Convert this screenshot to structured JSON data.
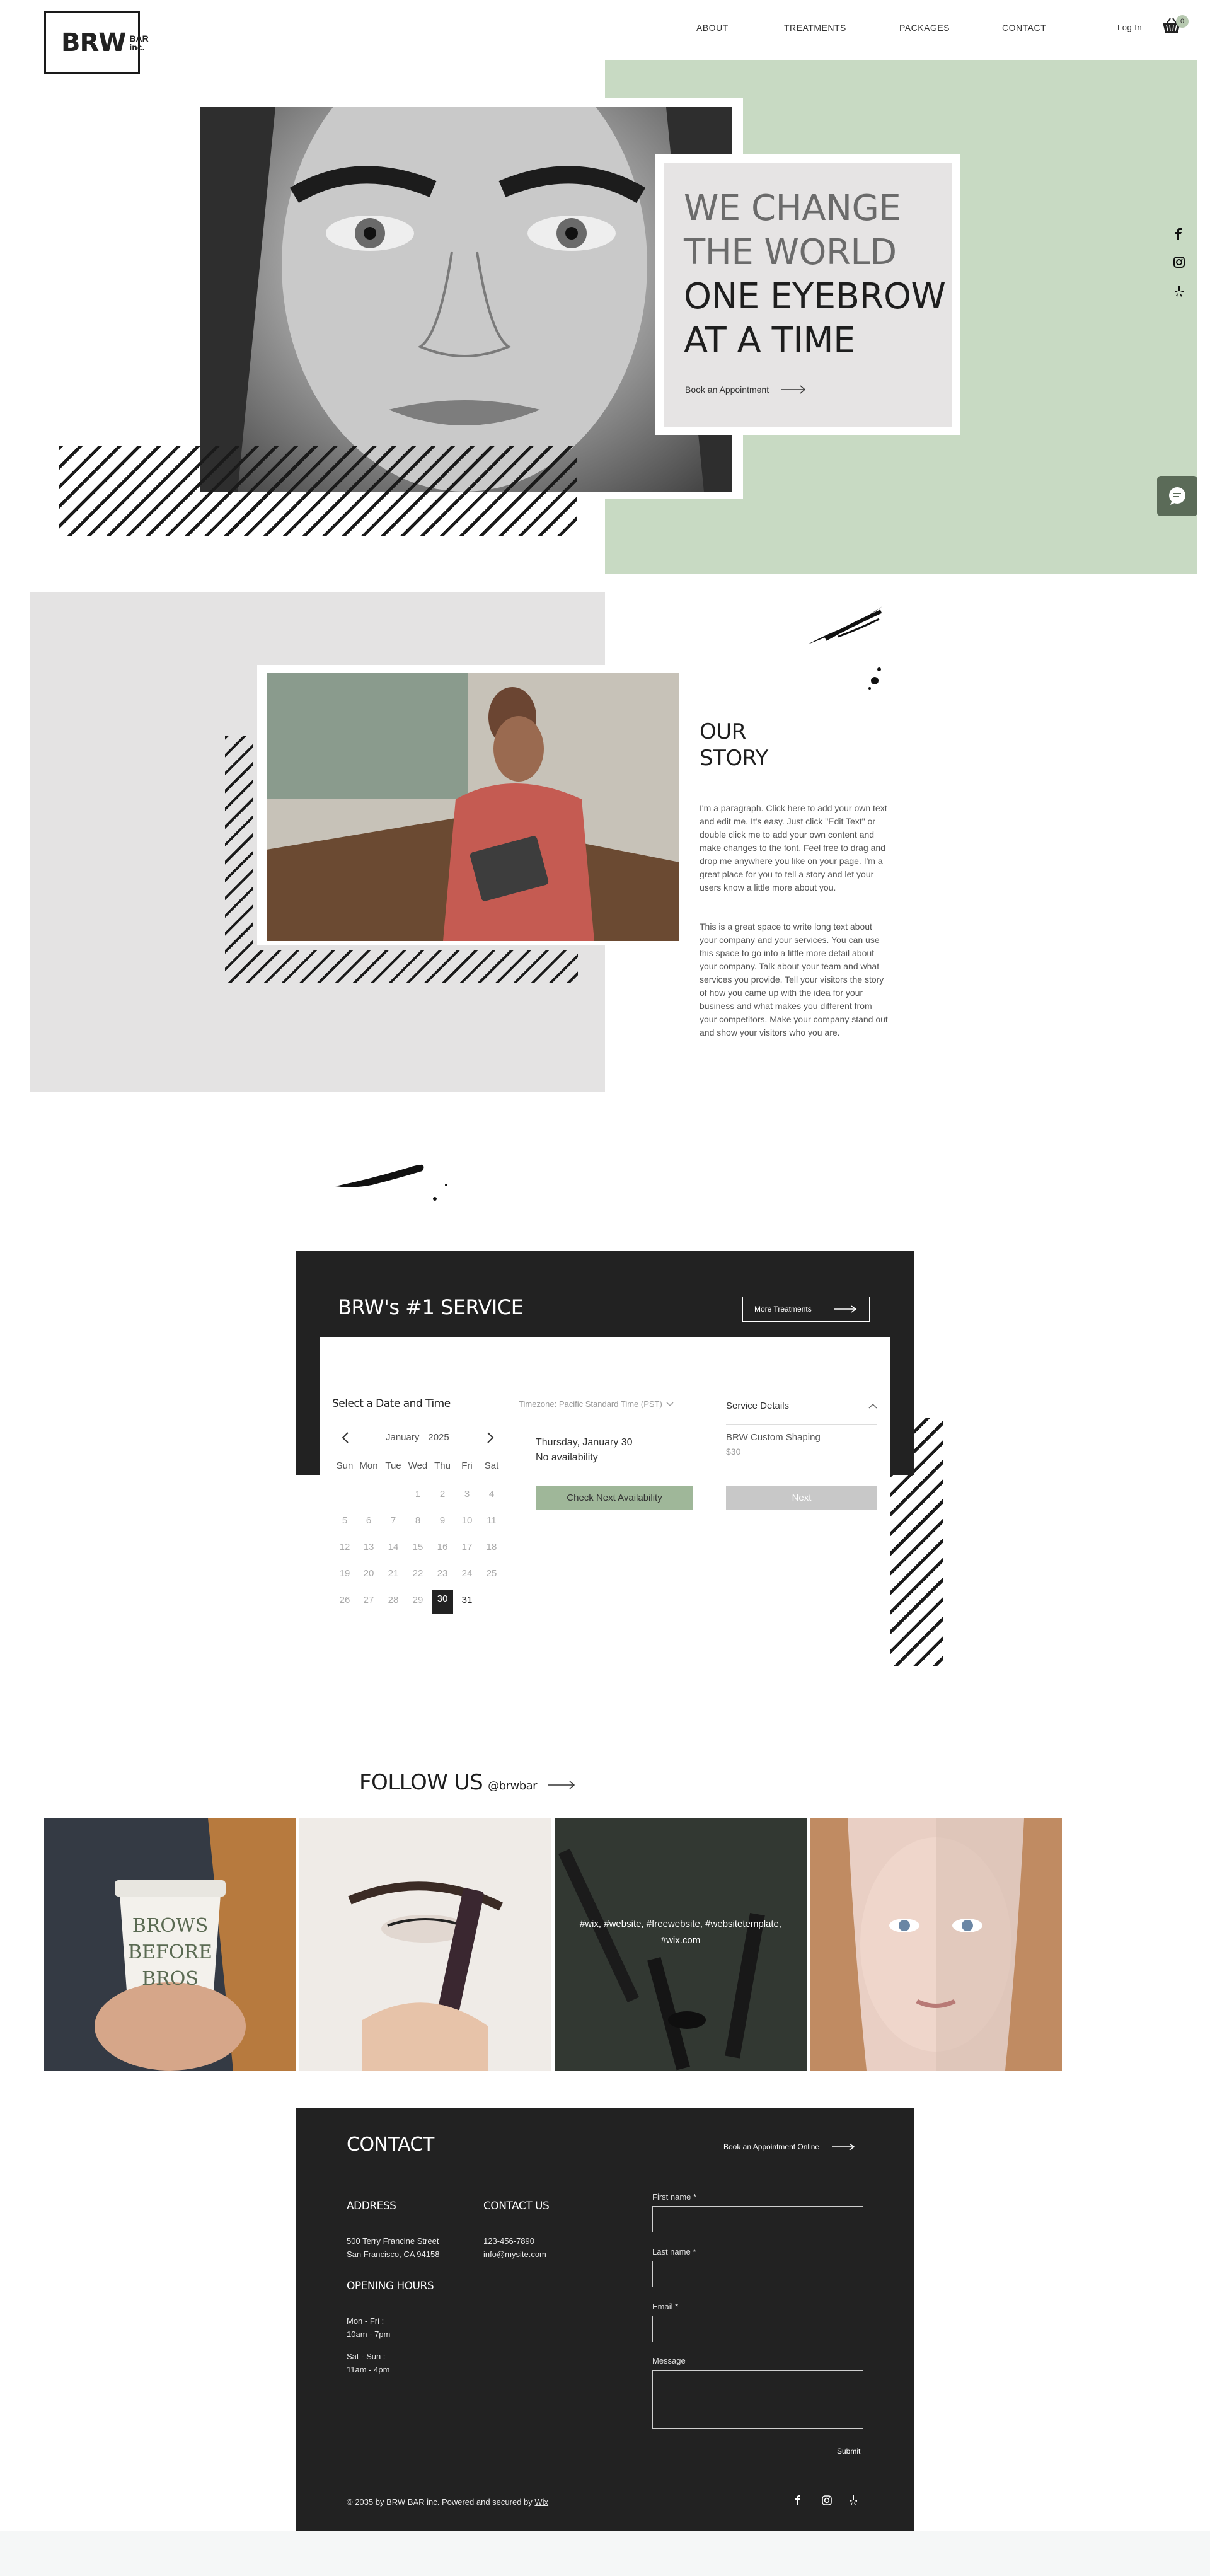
{
  "header": {
    "logo_big": "BRW",
    "logo_small_1": "BAR",
    "logo_small_2": "inc.",
    "nav": [
      "ABOUT",
      "TREATMENTS",
      "PACKAGES",
      "CONTACT"
    ],
    "login": "Log In",
    "cart_count": "0"
  },
  "hero": {
    "line1": "WE CHANGE",
    "line2": "THE WORLD",
    "line3": "ONE EYEBROW",
    "line4": "AT A TIME",
    "cta": "Book an Appointment",
    "colors": {
      "green": "#c8dac3",
      "card": "#e6e4e4"
    },
    "side_social": [
      "facebook-icon",
      "instagram-icon",
      "yelp-icon"
    ]
  },
  "story": {
    "title_1": "OUR",
    "title_2": "STORY",
    "p1": "I'm a paragraph. Click here to add your own text and edit me. It's easy. Just click \"Edit Text\" or double click me to add your own content and make changes to the font. Feel free to drag and drop me anywhere you like on your page. I'm a great place for you to tell a story and let your users know a little more about you.",
    "p2": "This is a great space to write long text about your company and your services. You can use this space to go into a little more detail about your company. Talk about your team and what services you provide. Tell your visitors the story of how you came up with the idea for your business and what makes you different from your competitors. Make your company stand out and show your visitors who you are."
  },
  "service": {
    "title": "BRW's #1 SERVICE",
    "more_btn": "More Treatments",
    "select_label": "Select a Date and Time",
    "timezone": "Timezone: Pacific Standard Time (PST)",
    "month": "January",
    "year": "2025",
    "weekdays": [
      "Sun",
      "Mon",
      "Tue",
      "Wed",
      "Thu",
      "Fri",
      "Sat"
    ],
    "selected_date": "Thursday, January 30",
    "availability": "No availability",
    "check_btn": "Check Next Availability",
    "details_label": "Service Details",
    "service_name": "BRW Custom Shaping",
    "price": "$30",
    "next_btn": "Next",
    "green": "#9fb799"
  },
  "follow": {
    "title": "FOLLOW US",
    "handle": "@brwbar",
    "tile3_text_1": "#wix, #website, #freewebsite, #websitetemplate,",
    "tile3_text_2": "#wix.com",
    "cup_1": "BROWS",
    "cup_2": "BEFORE",
    "cup_3": "BROS"
  },
  "contact": {
    "title": "CONTACT",
    "book_online": "Book an Appointment Online",
    "address_h": "ADDRESS",
    "address_1": "500 Terry Francine Street",
    "address_2": "San Francisco, CA 94158",
    "contact_h": "CONTACT US",
    "phone": "123-456-7890",
    "email": "info@mysite.com",
    "hours_h": "OPENING HOURS",
    "hours_1a": "Mon - Fri :",
    "hours_1b": "10am - 7pm",
    "hours_2a": "Sat - Sun :",
    "hours_2b": "11am - 4pm",
    "f_first": "First name *",
    "f_last": "Last name *",
    "f_email": "Email *",
    "f_message": "Message",
    "submit": "Submit",
    "copyright": "© 2035 by BRW BAR inc. Powered and secured by ",
    "wix": "Wix"
  }
}
